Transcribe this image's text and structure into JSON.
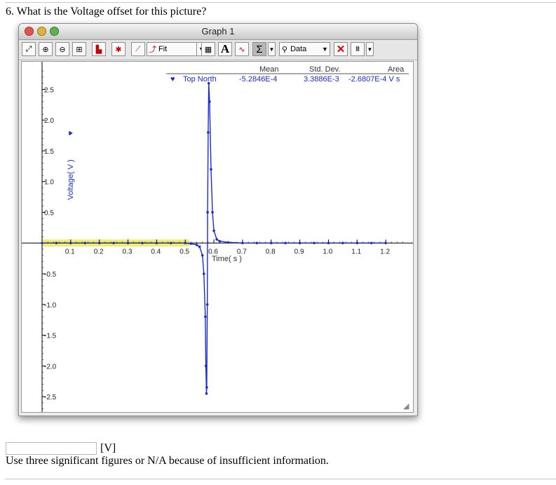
{
  "question": {
    "text": "6. What is the Voltage offset for this picture?"
  },
  "window": {
    "title": "Graph 1"
  },
  "toolbar": {
    "fit_label": "Fit",
    "text_tool_label": "A",
    "stats_label": "Σ",
    "data_label": "Data"
  },
  "stats": {
    "header_mean": "Mean",
    "header_std": "Std. Dev.",
    "header_area": "Area",
    "series_name": "Top North",
    "mean": "-5.2846E-4",
    "std": "3.3886E-3",
    "area": "-2.6807E-4 V s"
  },
  "colors": {
    "series": "#1a2bd6",
    "highlight": "#f2ec5a",
    "plot_bg": "#ffffff"
  },
  "chart_data": {
    "type": "scatter",
    "title": "",
    "xlabel": "Time( s )",
    "ylabel": "Voltage( V )",
    "xlim": [
      0.0,
      1.3
    ],
    "ylim": [
      -2.75,
      2.95
    ],
    "x_ticks": [
      0.1,
      0.2,
      0.3,
      0.4,
      0.5,
      0.6,
      0.7,
      0.8,
      0.9,
      1.0,
      1.1,
      1.2
    ],
    "x_tick_labels": [
      "0.1",
      "0.2",
      "0.3",
      "0.4",
      "0.5",
      "0.6",
      "0.7",
      "0.8",
      "0.9",
      "1.0",
      "1.1",
      "1.2"
    ],
    "y_ticks": [
      2.5,
      2.0,
      1.5,
      1.0,
      0.5,
      -0.5,
      -1.0,
      -1.5,
      -2.0,
      -2.5
    ],
    "y_tick_labels": [
      "2.5",
      "2.0",
      "1.5",
      "1.0",
      "0.5",
      "-0.5",
      "-1.0",
      "-1.5",
      "-2.0",
      "-2.5"
    ],
    "grid": false,
    "legend": "top",
    "series": [
      {
        "name": "Top North",
        "color": "#1a2bd6",
        "x": [
          0.0,
          0.05,
          0.1,
          0.15,
          0.2,
          0.25,
          0.3,
          0.35,
          0.4,
          0.45,
          0.5,
          0.52,
          0.54,
          0.55,
          0.56,
          0.565,
          0.57,
          0.572,
          0.574,
          0.575,
          0.577,
          0.578,
          0.58,
          0.582,
          0.585,
          0.59,
          0.595,
          0.6,
          0.61,
          0.62,
          0.65,
          0.7,
          0.75,
          0.8,
          0.85,
          0.9,
          0.95,
          1.0,
          1.05,
          1.1,
          1.15,
          1.2
        ],
        "y": [
          0.0,
          0.0,
          0.0,
          0.0,
          0.0,
          0.0,
          0.0,
          0.0,
          0.0,
          0.0,
          0.0,
          -0.01,
          -0.03,
          -0.06,
          -0.2,
          -0.5,
          -1.2,
          -2.0,
          -2.45,
          -2.35,
          -1.0,
          0.5,
          1.8,
          2.6,
          2.3,
          1.2,
          0.5,
          0.2,
          0.06,
          0.03,
          0.01,
          0.0,
          0.0,
          0.0,
          0.0,
          0.0,
          0.0,
          0.0,
          0.0,
          0.0,
          0.0,
          0.0
        ]
      }
    ],
    "highlight_range": {
      "x_start": 0.0,
      "x_end": 0.5,
      "color": "#f2ec5a"
    }
  },
  "answer": {
    "value": "",
    "unit": "[V]"
  },
  "instruction": {
    "text": "Use three significant figures or N/A because of insufficient information."
  }
}
